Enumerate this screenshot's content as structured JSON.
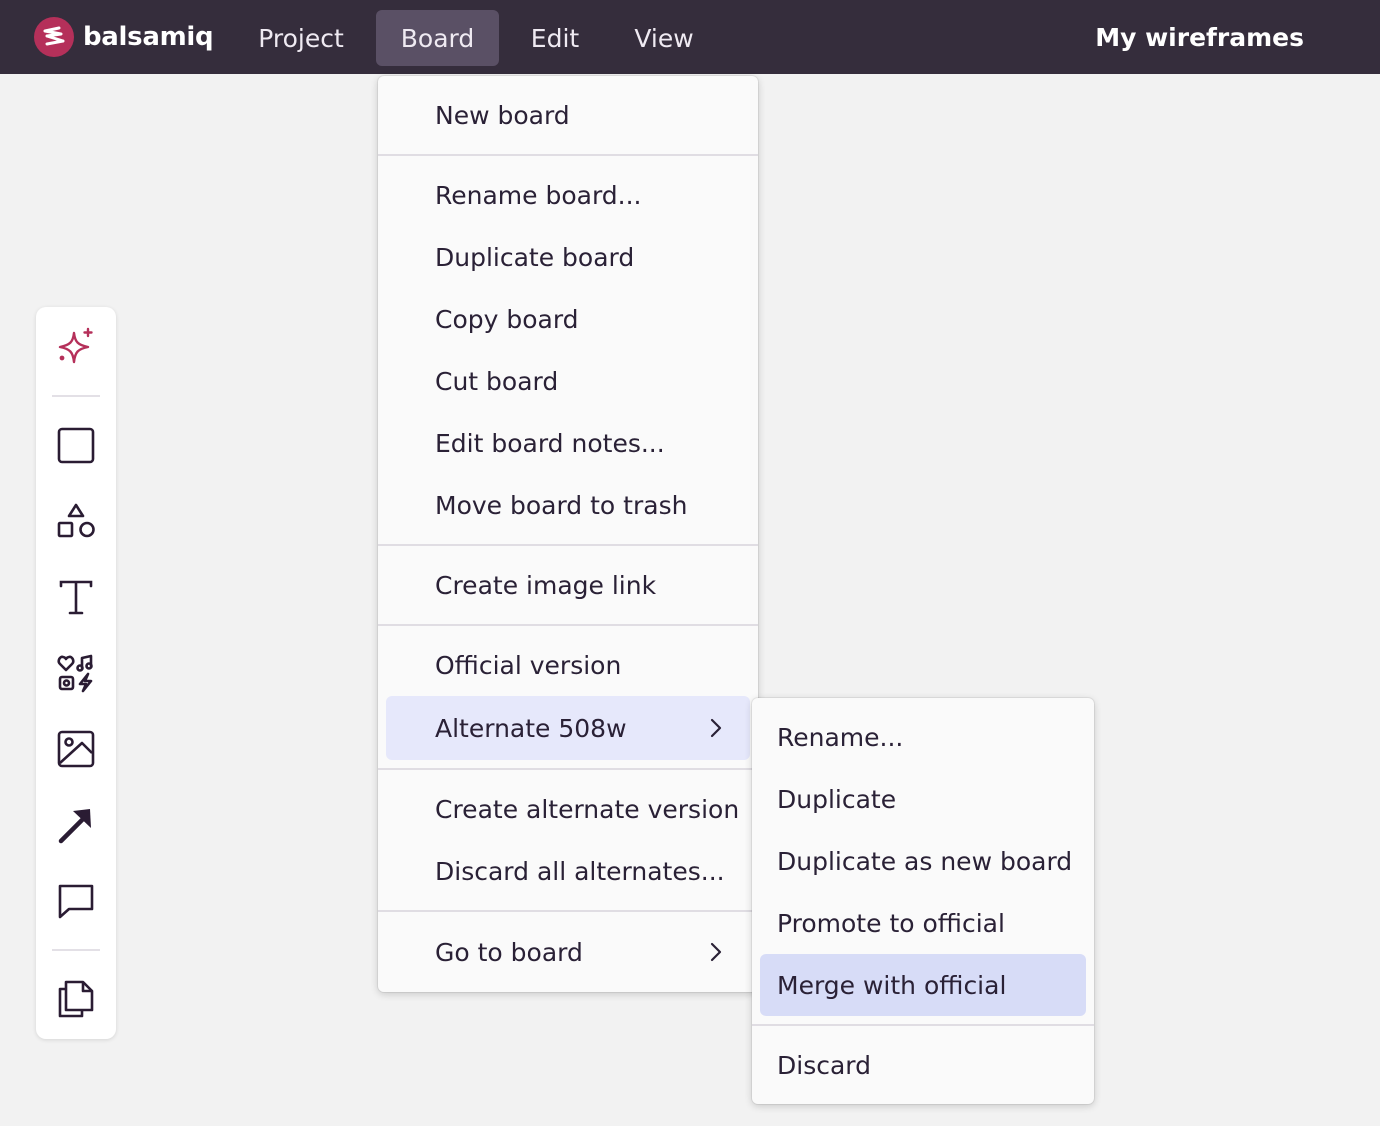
{
  "app": {
    "brand": "balsamiq",
    "menus": [
      "Project",
      "Board",
      "Edit",
      "View"
    ],
    "active_menu": "Board",
    "right_title": "My wireframes"
  },
  "toolbar": {
    "tools": [
      "sparkle-icon",
      "rectangle-icon",
      "shapes-icon",
      "text-icon",
      "icons-library-icon",
      "image-icon",
      "arrow-icon",
      "comment-icon",
      "copy-pages-icon"
    ]
  },
  "board_menu": {
    "new_board": "New board",
    "rename_board": "Rename board...",
    "duplicate_board": "Duplicate board",
    "copy_board": "Copy board",
    "cut_board": "Cut board",
    "edit_board_notes": "Edit board notes...",
    "move_to_trash": "Move board to trash",
    "create_image_link": "Create image link",
    "official_version": "Official version",
    "alternate": "Alternate 508w",
    "create_alternate": "Create alternate version",
    "discard_alternates": "Discard all alternates...",
    "go_to_board": "Go to board"
  },
  "alternate_submenu": {
    "rename": "Rename...",
    "duplicate": "Duplicate",
    "duplicate_new_board": "Duplicate as new board",
    "promote": "Promote to official",
    "merge": "Merge with official",
    "discard": "Discard"
  },
  "colors": {
    "topbar": "#352d3c",
    "accent": "#b5305a",
    "highlight": "#e6e8fb",
    "highlight_strong": "#d7dcf7"
  }
}
